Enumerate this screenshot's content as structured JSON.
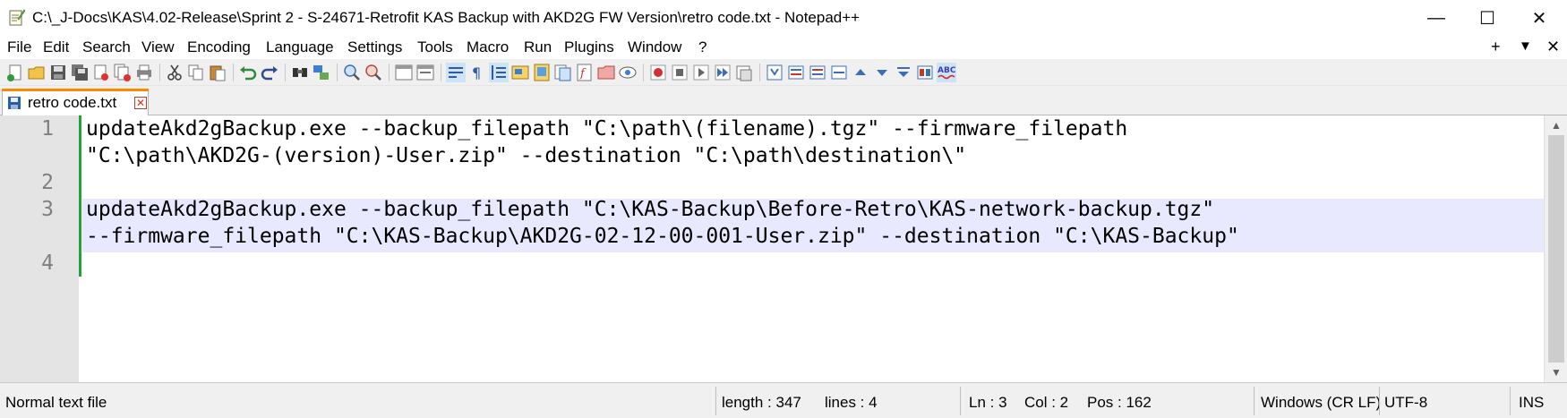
{
  "window": {
    "title": "C:\\_J-Docs\\KAS\\4.02-Release\\Sprint 2 - S-24671-Retrofit KAS Backup with AKD2G FW Version\\retro code.txt - Notepad++",
    "minimize_glyph": "—",
    "maximize_glyph": "☐",
    "close_glyph": "✕"
  },
  "menu": {
    "items": [
      "File",
      "Edit",
      "Search",
      "View",
      "Encoding",
      "Language",
      "Settings",
      "Tools",
      "Macro",
      "Run",
      "Plugins",
      "Window",
      "?"
    ],
    "right": [
      "+",
      "▼",
      "✕"
    ]
  },
  "toolbar": {
    "icons": [
      "new-file-icon",
      "open-file-icon",
      "save-icon",
      "save-all-icon",
      "close-icon",
      "close-all-icon",
      "print-icon",
      "cut-icon",
      "copy-icon",
      "paste-icon",
      "undo-icon",
      "redo-icon",
      "find-icon",
      "replace-icon",
      "zoom-in-icon",
      "zoom-out-icon",
      "sync-vertical-icon",
      "sync-horizontal-icon",
      "word-wrap-icon",
      "show-all-characters-icon",
      "indent-guide-icon",
      "user-defined-language-icon",
      "document-map-icon",
      "document-list-icon",
      "function-list-icon",
      "folder-as-workspace-icon",
      "monitoring-icon",
      "record-macro-icon",
      "stop-recording-icon",
      "playback-macro-icon",
      "run-macro-multiple-icon",
      "save-macro-icon",
      "plugin-a-icon",
      "plugin-b-icon",
      "plugin-c-icon",
      "plugin-d-icon",
      "move-up-icon",
      "move-down-icon",
      "plugin-e-icon",
      "plugin-f-icon",
      "spell-check-icon"
    ]
  },
  "tab": {
    "label": "retro code.txt",
    "close_glyph": "✕"
  },
  "editor": {
    "line_numbers": [
      "1",
      "2",
      "3",
      "4"
    ],
    "lines": [
      "updateAkd2gBackup.exe --backup_filepath \"C:\\path\\(filename).tgz\" --firmware_filepath",
      "\"C:\\path\\AKD2G-(version)-User.zip\" --destination \"C:\\path\\destination\\\"",
      "",
      "updateAkd2gBackup.exe --backup_filepath \"C:\\KAS-Backup\\Before-Retro\\KAS-network-backup.tgz\"",
      "--firmware_filepath \"C:\\KAS-Backup\\AKD2G-02-12-00-001-User.zip\" --destination \"C:\\KAS-Backup\"",
      ""
    ],
    "current_line_highlight": "#e8e8ff",
    "change_bar_color": "#22a33a"
  },
  "statusbar": {
    "file_type": "Normal text file",
    "length": "length : 347",
    "lines": "lines : 4",
    "ln": "Ln : 3",
    "col": "Col : 2",
    "pos": "Pos : 162",
    "eol": "Windows (CR LF)",
    "encoding": "UTF-8",
    "mode": "INS"
  }
}
